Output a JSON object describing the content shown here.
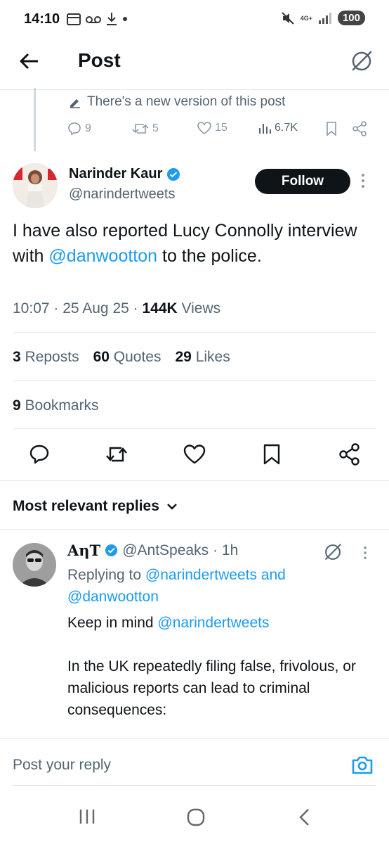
{
  "status_bar": {
    "time": "14:10",
    "network": "4G+",
    "battery": "100"
  },
  "header": {
    "title": "Post"
  },
  "parent": {
    "new_version_text": "There's a new version of this post",
    "replies": "9",
    "reposts": "5",
    "likes": "15",
    "views": "6.7K"
  },
  "author": {
    "name": "Narinder Kaur",
    "handle": "@narindertweets",
    "follow_label": "Follow"
  },
  "tweet": {
    "text_part1": "I have also reported Lucy Connolly interview with ",
    "mention": "@danwootton",
    "text_part2": " to the police.",
    "time_date": "10:07 · 25 Aug 25 · ",
    "views_count": "144K",
    "views_label": " Views"
  },
  "stats": {
    "reposts_count": "3",
    "reposts_label": "Reposts",
    "quotes_count": "60",
    "quotes_label": "Quotes",
    "likes_count": "29",
    "likes_label": "Likes",
    "bookmarks_count": "9",
    "bookmarks_label": "Bookmarks"
  },
  "replies_section": {
    "sort_label": "Most relevant replies"
  },
  "reply": {
    "name": "AηT",
    "handle": "@AntSpeaks",
    "time": "· 1h",
    "replying_prefix": "Replying to ",
    "replying_to_1": "@narindertweets",
    "replying_and": " and",
    "replying_to_2": "@danwootton",
    "body_prefix": "Keep in mind ",
    "body_mention": "@narindertweets",
    "body_para": "In the UK repeatedly filing false, frivolous, or malicious reports can lead to criminal consequences:"
  },
  "compose": {
    "placeholder": "Post your reply"
  },
  "colors": {
    "accent": "#1d9bf0",
    "text": "#0f1419",
    "muted": "#536471",
    "verified": "#1d9bf0"
  }
}
